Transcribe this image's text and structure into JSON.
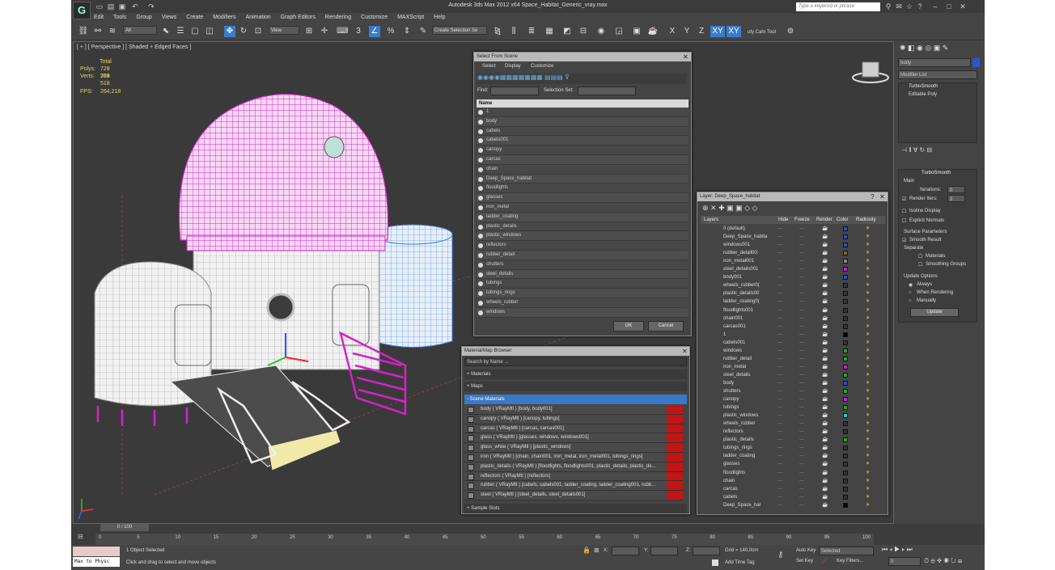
{
  "app": {
    "title": "Autodesk 3ds Max  2012 x64     Space_Habitat_Generic_vray.max",
    "search_placeholder": "Type a keyword or phrase",
    "menu": [
      "Edit",
      "Tools",
      "Group",
      "Views",
      "Create",
      "Modifiers",
      "Animation",
      "Graph Editors",
      "Rendering",
      "Customize",
      "MAXScript",
      "Help"
    ]
  },
  "toolbar": {
    "filter_all": "All",
    "ref_coord": "View",
    "selection_set": "Create Selection Se",
    "axes": [
      "X",
      "Y",
      "Z",
      "XY",
      "XY"
    ],
    "camtool": "uty Cam Tool"
  },
  "viewport": {
    "label": "[ + ] [ Perspective ] [ Shaded + Edged Faces ]",
    "stats": {
      "total_label": "Total",
      "polys_label": "Polys:",
      "polys": "728 764",
      "verts_label": "Verts:",
      "verts": "378 518",
      "fps_label": "FPS:",
      "fps": "264,218"
    }
  },
  "select_dialog": {
    "title": "Select From Scene",
    "menu": [
      "Select",
      "Display",
      "Customize"
    ],
    "find_label": "Find:",
    "selset_label": "Selection Set:",
    "col_name": "Name",
    "items": [
      "1",
      "body",
      "cabels",
      "cabels001",
      "canopy",
      "carcas",
      "chain",
      "Deep_Space_habitat",
      "floodlights",
      "glasses",
      "iron_metal",
      "ladder_coating",
      "plastic_details",
      "plastic_windows",
      "reflectors",
      "rubber_detail",
      "shutters",
      "steel_details",
      "tubings",
      "tubings_rings",
      "wheels_rubber",
      "windows"
    ],
    "ok": "OK",
    "cancel": "Cancel"
  },
  "material_browser": {
    "title": "Material/Map Browser",
    "search": "Search by Name ...",
    "groups": [
      "+ Materials",
      "+ Maps",
      "- Scene Materials"
    ],
    "materials": [
      "body  ( VRayMtl ) [body, body001]",
      "canopy  ( VRayMtl ) [canopy, tubings]",
      "carcas  ( VRayMtl ) [carcas, carcas001]",
      "glass  ( VRayMtl ) [glasses, windows, windows001]",
      "glass_white  ( VRayMtl ) [plastic_windows]",
      "iron  ( VRayMtl ) [chain, chain001, iron_metal, iron_metal001, tubings_rings]",
      "plastic_details  ( VRayMtl ) [floodlights, floodlights001, plastic_details, plastic_de...",
      "reflectors  ( VRayMtl ) [reflectors]",
      "rubber  ( VRayMtl ) [cabels, cabels001, ladder_coating, ladder_coating001, rubb...",
      "steel  ( VRayMtl ) [steel_details, steel_details001]"
    ],
    "sample_slots": "+ Sample Slots"
  },
  "layer_dialog": {
    "title": "Layer: Deep_Space_habitat",
    "headers": [
      "Layers",
      "Hide",
      "Freeze",
      "Render",
      "Color",
      "Radiosity"
    ],
    "rows": [
      {
        "name": "0 (default)",
        "color": "#2255cc"
      },
      {
        "name": "Deep_Space_habita",
        "color": "#2255cc"
      },
      {
        "name": "windows001",
        "color": "#2255cc"
      },
      {
        "name": "rubber_detail00:",
        "color": "#886622"
      },
      {
        "name": "iron_metal001",
        "color": "#888888"
      },
      {
        "name": "steel_details001",
        "color": "#cc22cc"
      },
      {
        "name": "body001",
        "color": "#2255cc"
      },
      {
        "name": "wheels_rubber0(",
        "color": "#333333"
      },
      {
        "name": "plastic_details00",
        "color": "#333333"
      },
      {
        "name": "ladder_coating0(",
        "color": "#333333"
      },
      {
        "name": "floodlights001",
        "color": "#333333"
      },
      {
        "name": "chain001",
        "color": "#333333"
      },
      {
        "name": "carcas001",
        "color": "#333333"
      },
      {
        "name": "1",
        "color": "#000000"
      },
      {
        "name": "cabels001",
        "color": "#333333"
      },
      {
        "name": "windows",
        "color": "#22aa22"
      },
      {
        "name": "rubber_detail",
        "color": "#22aa22"
      },
      {
        "name": "iron_metal",
        "color": "#cc22cc"
      },
      {
        "name": "steel_details",
        "color": "#22aa22"
      },
      {
        "name": "body",
        "color": "#2255cc"
      },
      {
        "name": "shutters",
        "color": "#22aa22"
      },
      {
        "name": "canopy",
        "color": "#cc22cc"
      },
      {
        "name": "tubings",
        "color": "#22aa22"
      },
      {
        "name": "plastic_windows",
        "color": "#22cccc"
      },
      {
        "name": "wheels_rubber",
        "color": "#333333"
      },
      {
        "name": "reflectors",
        "color": "#333333"
      },
      {
        "name": "plastic_details",
        "color": "#22aa22"
      },
      {
        "name": "tubings_rings",
        "color": "#333333"
      },
      {
        "name": "ladder_coating",
        "color": "#333333"
      },
      {
        "name": "glasses",
        "color": "#333333"
      },
      {
        "name": "floodlights",
        "color": "#333333"
      },
      {
        "name": "chain",
        "color": "#333333"
      },
      {
        "name": "carcas",
        "color": "#333333"
      },
      {
        "name": "cabels",
        "color": "#333333"
      },
      {
        "name": "Deep_Space_hal",
        "color": "#000000"
      }
    ]
  },
  "command_panel": {
    "object_name": "body",
    "modifier_list": "Modifier List",
    "stack": [
      "TurboSmooth",
      "Editable Poly"
    ],
    "ts_title": "TurboSmooth",
    "main": "Main",
    "iterations_label": "Iterations:",
    "iterations": "0",
    "render_iters_label": "Render Iters:",
    "render_iters": "2",
    "isoline": "Isoline Display",
    "explicit": "Explicit Normals",
    "surface_params": "Surface Parameters",
    "smooth_result": "Smooth Result",
    "separate": "Separate",
    "materials": "Materials",
    "smoothing_groups": "Smoothing Groups",
    "update_options": "Update Options",
    "always": "Always",
    "when_rendering": "When Rendering",
    "manually": "Manually",
    "update": "Update"
  },
  "timeline": {
    "frame": "0 / 100",
    "ticks": [
      "0",
      "5",
      "10",
      "15",
      "20",
      "25",
      "30",
      "35",
      "40",
      "45",
      "50",
      "55",
      "60",
      "65",
      "70",
      "75",
      "80",
      "85",
      "90",
      "95",
      "100"
    ]
  },
  "status": {
    "script": "Max to Physc",
    "selected": "1 Object Selected",
    "prompt": "Click and drag to select and move objects",
    "x_label": "X:",
    "y_label": "Y:",
    "z_label": "Z:",
    "grid": "Grid = 140,0cm",
    "add_time_tag": "Add Time Tag",
    "auto_key": "Auto Key",
    "auto_key_val": "Selected",
    "set_key": "Set Key",
    "key_filters": "Key Filters...",
    "frame_field": "0"
  }
}
